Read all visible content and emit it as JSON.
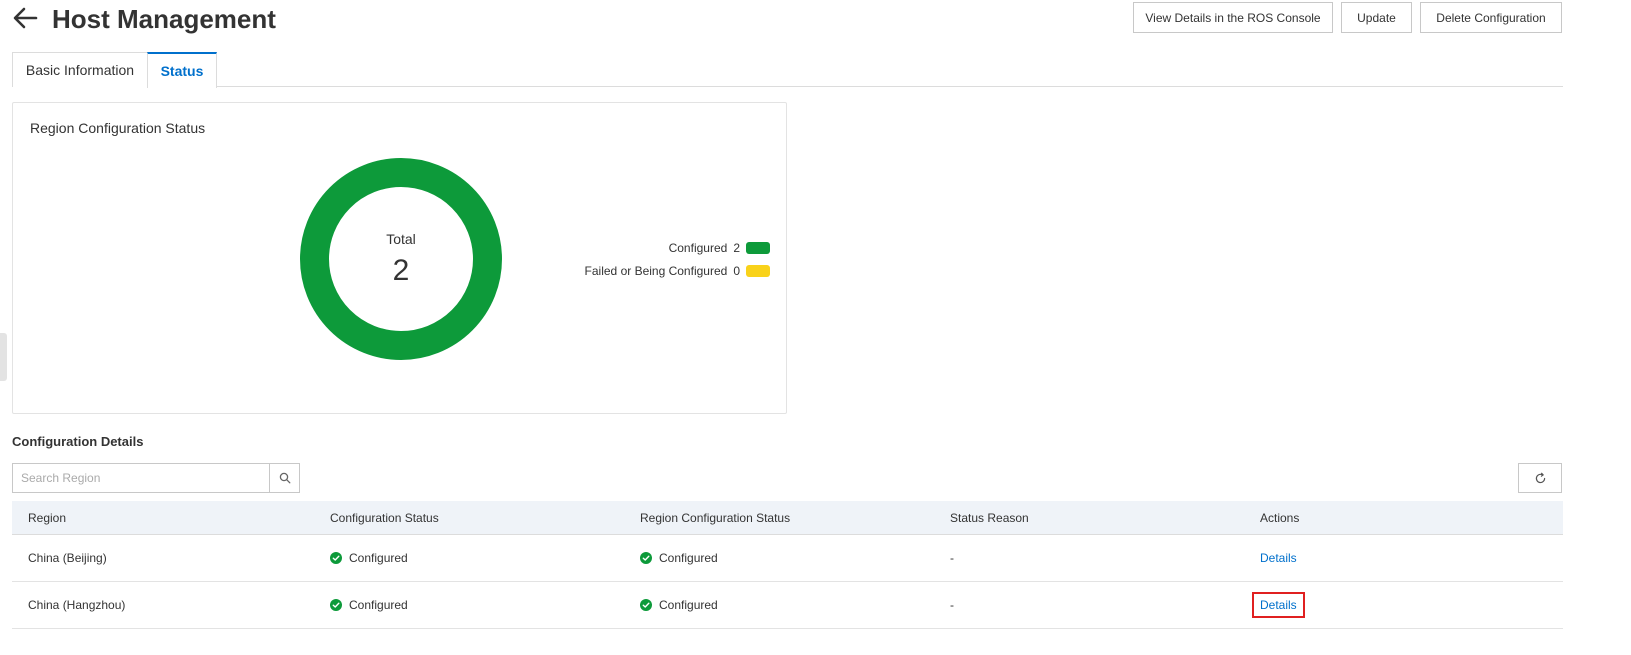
{
  "header": {
    "title": "Host Management",
    "buttons": {
      "view_ros": "View Details in the ROS Console",
      "update": "Update",
      "delete": "Delete Configuration"
    }
  },
  "tabs": [
    {
      "label": "Basic Information",
      "active": false
    },
    {
      "label": "Status",
      "active": true
    }
  ],
  "status_card": {
    "title": "Region Configuration Status",
    "total_label": "Total",
    "total_value": "2",
    "legend": [
      {
        "label": "Configured",
        "count": "2",
        "color": "#0d9a3a"
      },
      {
        "label": "Failed or Being Configured",
        "count": "0",
        "color": "#f9d21a"
      }
    ]
  },
  "config_details": {
    "title": "Configuration Details",
    "search": {
      "placeholder": "Search Region",
      "value": ""
    },
    "columns": [
      "Region",
      "Configuration Status",
      "Region Configuration Status",
      "Status Reason",
      "Actions"
    ],
    "rows": [
      {
        "region": "China (Beijing)",
        "config_status": "Configured",
        "region_config_status": "Configured",
        "reason": "-",
        "action": "Details",
        "highlighted": false
      },
      {
        "region": "China (Hangzhou)",
        "config_status": "Configured",
        "region_config_status": "Configured",
        "reason": "-",
        "action": "Details",
        "highlighted": true
      }
    ]
  },
  "colors": {
    "accent": "#0070cc",
    "success": "#0d9a3a",
    "warning": "#f9d21a",
    "highlight": "#e02020"
  },
  "icons": [
    "back-arrow-icon",
    "search-icon",
    "refresh-icon",
    "check-circle-icon"
  ]
}
